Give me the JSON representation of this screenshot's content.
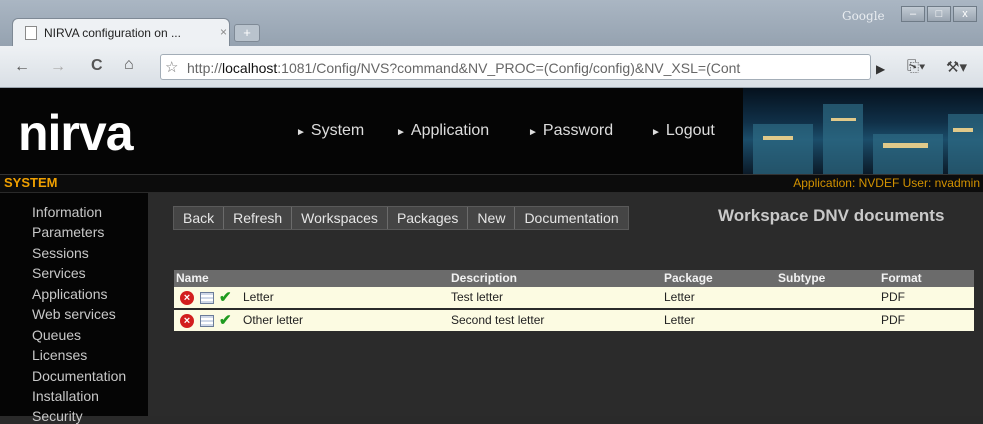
{
  "browser": {
    "tab_title": "NIRVA configuration on ...",
    "tab_close": "×",
    "newtab": "+",
    "google": "Google",
    "win_minimize": "–",
    "win_maximize": "□",
    "win_close": "x",
    "url_prefix": "http://",
    "url_host": "localhost",
    "url_rest": ":1081/Config/NVS?command&NV_PROC=(Config/config)&NV_XSL=(Cont",
    "icons": {
      "back": "←",
      "forward": "→",
      "reload": "C",
      "home": "⌂",
      "star": "☆",
      "go": "▶",
      "page": "⎘▾",
      "wrench": "⚒▾"
    }
  },
  "header": {
    "logo": "nirva",
    "nav": [
      {
        "label": "System"
      },
      {
        "label": "Application"
      },
      {
        "label": "Password"
      },
      {
        "label": "Logout"
      }
    ],
    "nav_arrow": "►"
  },
  "sysbar": {
    "title": "SYSTEM",
    "info": "Application: NVDEF  User: nvadmin"
  },
  "sidebar": {
    "items": [
      {
        "label": "Information"
      },
      {
        "label": "Parameters"
      },
      {
        "label": "Sessions"
      },
      {
        "label": "Services"
      },
      {
        "label": "Applications"
      },
      {
        "label": "Web services"
      },
      {
        "label": "Queues"
      },
      {
        "label": "Licenses"
      },
      {
        "label": "Documentation"
      },
      {
        "label": "Installation"
      },
      {
        "label": "Security"
      }
    ]
  },
  "actions": [
    {
      "label": "Back"
    },
    {
      "label": "Refresh"
    },
    {
      "label": "Workspaces"
    },
    {
      "label": "Packages"
    },
    {
      "label": "New"
    },
    {
      "label": "Documentation"
    }
  ],
  "workspace_title": "Workspace DNV documents",
  "table": {
    "headers": {
      "name": "Name",
      "description": "Description",
      "package": "Package",
      "subtype": "Subtype",
      "format": "Format"
    },
    "icons": {
      "delete": "×",
      "ok": "✔"
    },
    "rows": [
      {
        "name": "Letter",
        "description": "Test letter",
        "package": "Letter",
        "subtype": "",
        "format": "PDF"
      },
      {
        "name": "Other letter",
        "description": "Second test letter",
        "package": "Letter",
        "subtype": "",
        "format": "PDF"
      }
    ]
  }
}
